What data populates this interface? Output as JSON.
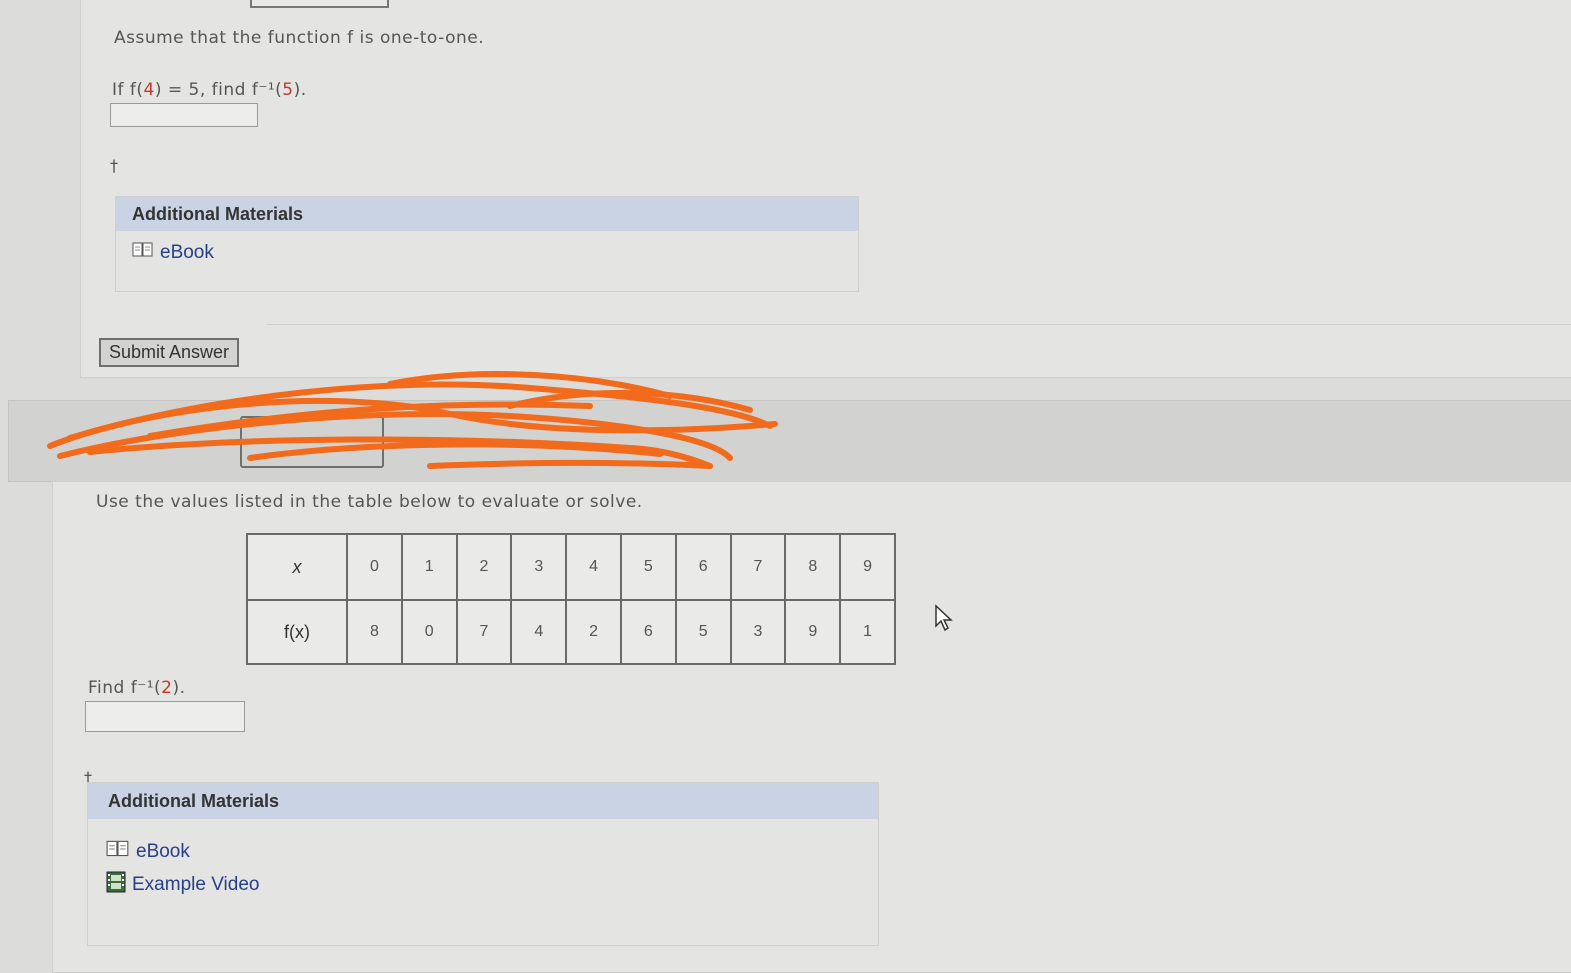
{
  "q1": {
    "intro": "Assume that the function f is one-to-one.",
    "prompt_if": "If",
    "prompt_given": "f(4) = 5,",
    "prompt_find": "find",
    "prompt_target": "f⁻¹(5).",
    "answer_value": "",
    "dagger": "†",
    "additional_materials": {
      "heading": "Additional Materials",
      "links": [
        {
          "label": "eBook",
          "icon": "book-icon"
        }
      ]
    },
    "submit_label": "Submit Answer"
  },
  "q2": {
    "intro": "Use the values listed in the table below to evaluate or solve.",
    "table": {
      "row_x_label": "x",
      "row_fx_label": "f(x)",
      "x_values": [
        "0",
        "1",
        "2",
        "3",
        "4",
        "5",
        "6",
        "7",
        "8",
        "9"
      ],
      "fx_values": [
        "8",
        "0",
        "7",
        "4",
        "2",
        "6",
        "5",
        "3",
        "9",
        "1"
      ]
    },
    "prompt_find": "Find",
    "prompt_target": "f⁻¹(2).",
    "answer_value": "",
    "dagger": "†",
    "additional_materials": {
      "heading": "Additional Materials",
      "links": [
        {
          "label": "eBook",
          "icon": "book-icon"
        },
        {
          "label": "Example Video",
          "icon": "film-icon"
        }
      ]
    }
  },
  "colors": {
    "scribble": "#f26a1b",
    "link": "#27408b",
    "am_header": "#c9d3e3",
    "red_value": "#c0392b"
  }
}
